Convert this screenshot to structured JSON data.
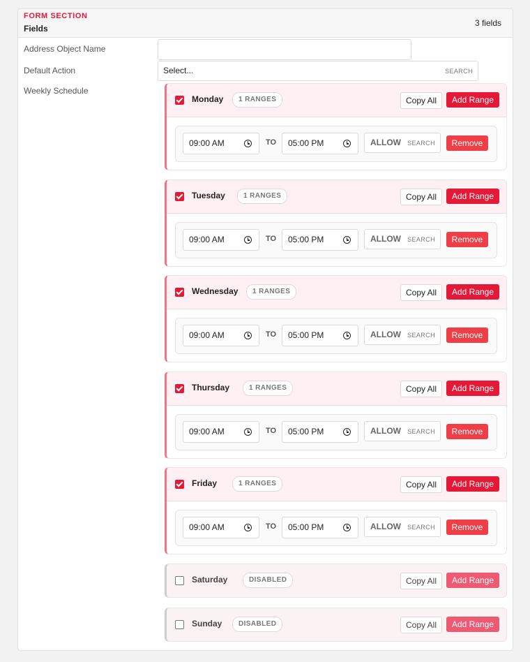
{
  "section": {
    "kicker": "FORM SECTION",
    "title": "Fields",
    "count": "3 fields"
  },
  "fields": {
    "address": {
      "label": "Address Object Name",
      "value": ""
    },
    "default_action": {
      "label": "Default Action",
      "placeholder": "Select...",
      "search": "SEARCH"
    },
    "schedule": {
      "label": "Weekly Schedule"
    }
  },
  "schedule": {
    "copy_label": "Copy All",
    "add_label": "Add Range",
    "remove_label": "Remove",
    "to_label": "TO",
    "search_label": "SEARCH",
    "days": [
      {
        "name": "Monday",
        "enabled": true,
        "badge": "1 RANGES",
        "range": {
          "start": "09:00 AM",
          "end": "05:00 PM",
          "action": "ALLOW"
        }
      },
      {
        "name": "Tuesday",
        "enabled": true,
        "badge": "1 RANGES",
        "range": {
          "start": "09:00 AM",
          "end": "05:00 PM",
          "action": "ALLOW"
        }
      },
      {
        "name": "Wednesday",
        "enabled": true,
        "badge": "1 RANGES",
        "range": {
          "start": "09:00 AM",
          "end": "05:00 PM",
          "action": "ALLOW"
        }
      },
      {
        "name": "Thursday",
        "enabled": true,
        "badge": "1 RANGES",
        "range": {
          "start": "09:00 AM",
          "end": "05:00 PM",
          "action": "ALLOW"
        }
      },
      {
        "name": "Friday",
        "enabled": true,
        "badge": "1 RANGES",
        "range": {
          "start": "09:00 AM",
          "end": "05:00 PM",
          "action": "ALLOW"
        }
      },
      {
        "name": "Saturday",
        "enabled": false,
        "badge": "DISABLED"
      },
      {
        "name": "Sunday",
        "enabled": false,
        "badge": "DISABLED"
      }
    ]
  },
  "colors": {
    "accent": "#e31937",
    "remove": "#ef3e46",
    "header_bg": "#fff1f3"
  }
}
